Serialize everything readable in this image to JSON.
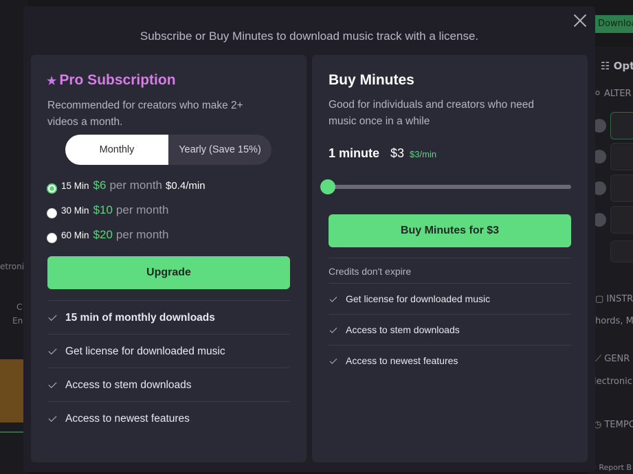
{
  "background": {
    "download_label": "Download",
    "right_panel": {
      "options_label": "Opt",
      "alter_label": "ALTER",
      "instr_label": "INSTR",
      "chords_label": "hords, M",
      "genre_label": "GENR",
      "electronic_label": "lectronic",
      "tempo_label": "TEMPO",
      "report_label": "Report B"
    },
    "left_panel": {
      "electronic_label": "etronic",
      "c_label": "C",
      "en_label": "En"
    }
  },
  "modal": {
    "title": "Subscribe or Buy Minutes to download music track with a license.",
    "close_label": "✕"
  },
  "pro": {
    "star": "★",
    "title": "Pro Subscription",
    "description": "Recommended for creators who make 2+ videos a month.",
    "toggle": {
      "monthly": "Monthly",
      "yearly": "Yearly (Save 15%)",
      "selected": "Monthly"
    },
    "plans": [
      {
        "minutes": "15 Min",
        "price": "$6",
        "per": "per month",
        "rate": "$0.4/min",
        "selected": true
      },
      {
        "minutes": "30 Min",
        "price": "$10",
        "per": "per month",
        "rate": "",
        "selected": false
      },
      {
        "minutes": "60 Min",
        "price": "$20",
        "per": "per month",
        "rate": "",
        "selected": false
      }
    ],
    "upgrade_label": "Upgrade",
    "features": [
      "15 min of monthly downloads",
      "Get license for downloaded music",
      "Access to stem downloads",
      "Access to newest features"
    ]
  },
  "buy": {
    "title": "Buy Minutes",
    "description": "Good for individuals and creators who need music once in a while",
    "minutes": "1 minute",
    "price": "$3",
    "rate": "$3/min",
    "slider_value": 1,
    "button_label": "Buy Minutes for $3",
    "credits_note": "Credits don't expire",
    "features": [
      "Get license for downloaded music",
      "Access to stem downloads",
      "Access to newest features"
    ]
  },
  "colors": {
    "accent_green": "#5fdc80",
    "pro_purple": "#d57ee6",
    "modal_bg": "#201f28",
    "card_bg": "#2a2936"
  }
}
